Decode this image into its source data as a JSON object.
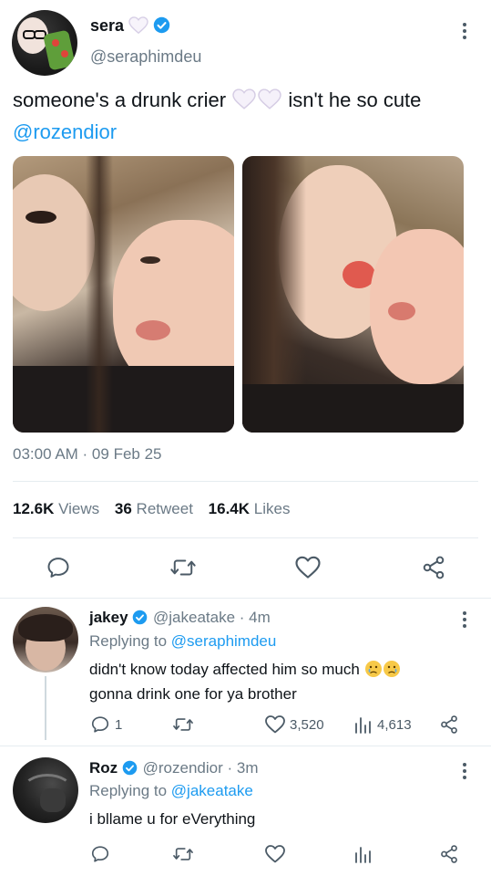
{
  "tweet": {
    "display_name": "sera",
    "handle": "@seraphimdeu",
    "text_before": "someone's a drunk crier",
    "text_after": "isn't he so cute",
    "mention": "@rozendior",
    "timestamp": "03:00 AM · 09 Feb 25",
    "stats": {
      "views_count": "12.6K",
      "views_label": "Views",
      "retweet_count": "36",
      "retweet_label": "Retweet",
      "likes_count": "16.4K",
      "likes_label": "Likes"
    }
  },
  "replies": [
    {
      "display_name": "jakey",
      "handle": "@jakeatake",
      "time": "· 4m",
      "replying_prefix": "Replying to",
      "replying_to": "@seraphimdeu",
      "text_line1": "didn't know today affected him so much",
      "text_line2": "gonna drink one for ya brother",
      "reply_count": "1",
      "like_count": "3,520",
      "view_count": "4,613"
    },
    {
      "display_name": "Roz",
      "handle": "@rozendior",
      "time": "· 3m",
      "replying_prefix": "Replying to",
      "replying_to": "@jakeatake",
      "text_line1": "i bllame u for eVerything"
    }
  ],
  "colors": {
    "accent": "#1d9bf0",
    "muted": "#6b7a86",
    "divider": "#e6ecf0"
  }
}
